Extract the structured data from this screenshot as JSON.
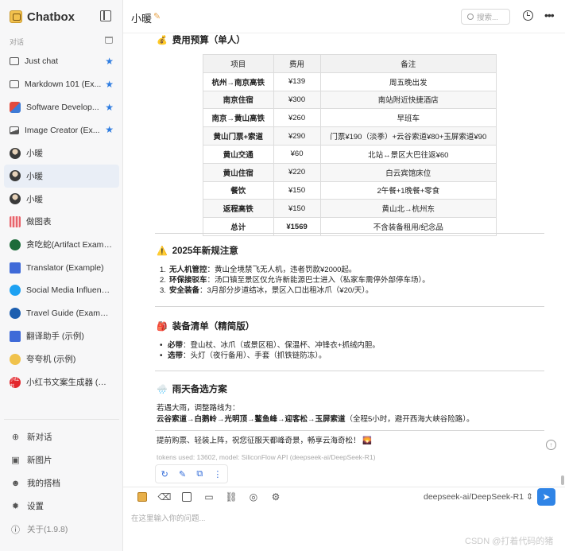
{
  "app": {
    "name": "Chatbox"
  },
  "sidebar": {
    "section_label": "对话",
    "items": [
      {
        "label": "Just chat",
        "icon": "chat-bubble-icon",
        "icon_class": "ic-bubble",
        "starred": true,
        "active": false
      },
      {
        "label": "Markdown 101 (Ex...",
        "icon": "chat-bubble-icon",
        "icon_class": "ic-bubble",
        "starred": true,
        "active": false
      },
      {
        "label": "Software Develop...",
        "icon": "developer-avatar-icon",
        "icon_class": "ic-sw",
        "starred": true,
        "active": false
      },
      {
        "label": "Image Creator (Ex...",
        "icon": "image-icon",
        "icon_class": "ic-img",
        "starred": true,
        "active": false
      },
      {
        "label": "小暖",
        "icon": "user-avatar-icon",
        "icon_class": "ic-avatar",
        "starred": false,
        "active": false
      },
      {
        "label": "小暖",
        "icon": "user-avatar-icon",
        "icon_class": "ic-avatar",
        "starred": false,
        "active": true
      },
      {
        "label": "小暖",
        "icon": "user-avatar-icon",
        "icon_class": "ic-avatar",
        "starred": false,
        "active": false
      },
      {
        "label": "做图表",
        "icon": "chart-icon",
        "icon_class": "ic-chart",
        "starred": false,
        "active": false
      },
      {
        "label": "贪吃蛇(Artifact Example)",
        "icon": "snake-icon",
        "icon_class": "ic-snake",
        "starred": false,
        "active": false
      },
      {
        "label": "Translator (Example)",
        "icon": "translator-icon",
        "icon_class": "ic-trans",
        "starred": false,
        "active": false
      },
      {
        "label": "Social Media Influencer ...",
        "icon": "twitter-icon",
        "icon_class": "ic-tw",
        "starred": false,
        "active": false
      },
      {
        "label": "Travel Guide (Example)",
        "icon": "travel-icon",
        "icon_class": "ic-travel",
        "starred": false,
        "active": false
      },
      {
        "label": "翻译助手 (示例)",
        "icon": "translator-icon",
        "icon_class": "ic-trans",
        "starred": false,
        "active": false
      },
      {
        "label": "夸夸机 (示例)",
        "icon": "boat-icon",
        "icon_class": "ic-boat",
        "starred": false,
        "active": false
      },
      {
        "label": "小红书文案生成器 (示例)",
        "icon": "xiaohongshu-icon",
        "icon_class": "ic-xhs",
        "icon_text": "小红书",
        "starred": false,
        "active": false
      }
    ],
    "bottom_menu": [
      {
        "label": "新对话",
        "icon": "plus-circle-icon",
        "glyph": "⊕"
      },
      {
        "label": "新图片",
        "icon": "image-icon",
        "glyph": "▣"
      },
      {
        "label": "我的搭档",
        "icon": "robot-icon",
        "glyph": "☻"
      },
      {
        "label": "设置",
        "icon": "gear-icon",
        "glyph": "✹"
      },
      {
        "label": "关于(1.9.8)",
        "icon": "info-icon",
        "glyph": "ⓘ",
        "muted": true
      }
    ]
  },
  "header": {
    "title": "小暖",
    "search_placeholder": "搜索..."
  },
  "message": {
    "budget_heading": "费用预算（单人）",
    "budget_emoji": "💰",
    "table": {
      "headers": [
        "项目",
        "费用",
        "备注"
      ],
      "rows": [
        [
          "杭州→南京高铁",
          "¥139",
          "周五晚出发"
        ],
        [
          "南京住宿",
          "¥300",
          "南站附近快捷酒店"
        ],
        [
          "南京→黄山高铁",
          "¥260",
          "早班车"
        ],
        [
          "黄山门票+索道",
          "¥290",
          "门票¥190（淡季）+云谷索道¥80+玉屏索道¥90"
        ],
        [
          "黄山交通",
          "¥60",
          "北站↔景区大巴往返¥60"
        ],
        [
          "黄山住宿",
          "¥220",
          "白云宾馆床位"
        ],
        [
          "餐饮",
          "¥150",
          "2午餐+1晚餐+零食"
        ],
        [
          "返程高铁",
          "¥150",
          "黄山北→杭州东"
        ],
        [
          "总计",
          "¥1569",
          "不含装备租用/纪念品"
        ]
      ]
    },
    "rules_heading": "2025年新规注意",
    "rules_emoji": "⚠️",
    "rules": [
      {
        "num": "1.",
        "bold": "无人机管控",
        "text": "：黄山全境禁飞无人机，违者罚款¥2000起。"
      },
      {
        "num": "2.",
        "bold": "环保接驳车",
        "text": "：汤口镇至景区仅允许新能源巴士进入（私家车需停外部停车场）。"
      },
      {
        "num": "3.",
        "bold": "安全装备",
        "text": "：3月部分步道结冰，景区入口出租冰爪（¥20/天）。"
      }
    ],
    "gear_heading": "装备清单（精简版）",
    "gear_emoji": "🎒",
    "gear": [
      {
        "bold": "必带",
        "text": "：登山杖、冰爪（或景区租）、保温杯、冲锋衣+抓绒内胆。"
      },
      {
        "bold": "选带",
        "text": "：头灯（夜行备用）、手套（抓铁链防冻）。"
      }
    ],
    "rain_heading": "雨天备选方案",
    "rain_emoji": "🌧️",
    "rain_line1": "若遇大雨，调整路线为：",
    "rain_route": "云谷索道→白鹅岭→光明顶→鳌鱼峰→迎客松→玉屏索道",
    "rain_note": "（全程5小时，避开西海大峡谷险路）。",
    "closing": "提前购票、轻装上阵，祝您征服天都峰奇景，畅享云海奇松！",
    "closing_emoji": "🌄",
    "meta": "tokens used: 13602, model: SiliconFlow API (deepseek-ai/DeepSeek-R1)"
  },
  "input": {
    "model": "deepseek-ai/DeepSeek-R1",
    "placeholder": "在这里输入你的问题..."
  },
  "watermark": "CSDN @打着代码的猪",
  "colors": {
    "accent": "#2f84e6",
    "star": "#2f7de1",
    "active_bg": "#e9eef6"
  }
}
